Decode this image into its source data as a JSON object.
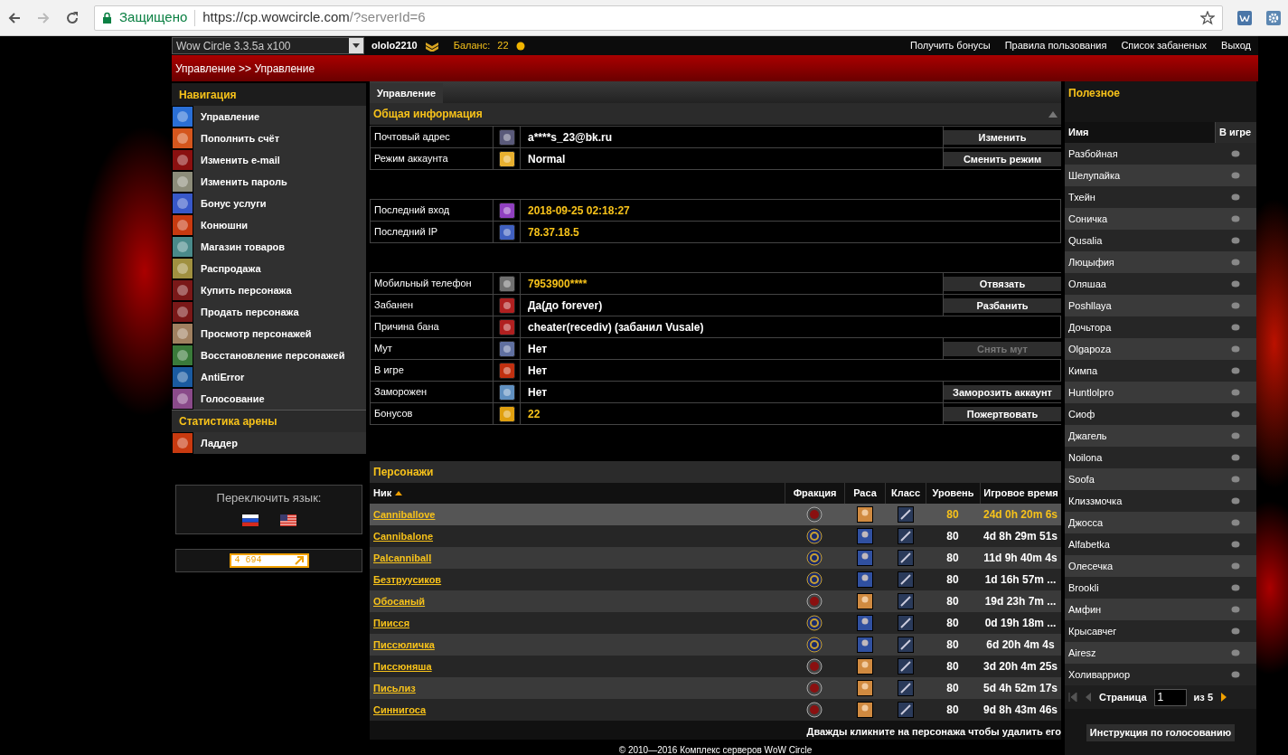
{
  "browser": {
    "security_label": "Защищено",
    "url_host": "https://cp.wowcircle.com",
    "url_path": "/?serverId=6"
  },
  "topbar": {
    "server_select": "Wow Circle 3.3.5a x100",
    "username": "ololo2210",
    "balance_label": "Баланс:",
    "balance": "22",
    "links": [
      "Получить бонусы",
      "Правила пользования",
      "Список забаненых",
      "Выход"
    ]
  },
  "breadcrumb": "Управление >> Управление",
  "sidebar": {
    "title": "Навигация",
    "items": [
      {
        "label": "Управление"
      },
      {
        "label": "Пополнить счёт"
      },
      {
        "label": "Изменить e-mail"
      },
      {
        "label": "Изменить пароль"
      },
      {
        "label": "Бонус услуги"
      },
      {
        "label": "Конюшни"
      },
      {
        "label": "Магазин товаров"
      },
      {
        "label": "Распродажа"
      },
      {
        "label": "Купить персонажа"
      },
      {
        "label": "Продать персонажа"
      },
      {
        "label": "Просмотр персонажей"
      },
      {
        "label": "Восстановление персонажей"
      },
      {
        "label": "AntiError"
      },
      {
        "label": "Голосование"
      }
    ],
    "arena_title": "Статистика арены",
    "arena_items": [
      {
        "label": "Ладдер"
      }
    ],
    "language_title": "Переключить язык:",
    "counter": "4 694"
  },
  "main": {
    "tab": "Управление",
    "section_title": "Общая информация",
    "groups": [
      [
        {
          "label": "Почтовый адрес",
          "value": "a****s_23@bk.ru",
          "accent": false,
          "button": {
            "label": "Изменить",
            "disabled": false
          }
        },
        {
          "label": "Режим аккаунта",
          "value": "Normal",
          "accent": false,
          "button": {
            "label": "Сменить режим",
            "disabled": false
          }
        }
      ],
      [
        {
          "label": "Последний вход",
          "value": "2018-09-25 02:18:27",
          "accent": true
        },
        {
          "label": "Последний IP",
          "value": "78.37.18.5",
          "accent": true
        }
      ],
      [
        {
          "label": "Мобильный телефон",
          "value": "7953900****",
          "accent": true,
          "button": {
            "label": "Отвязать",
            "disabled": false
          }
        },
        {
          "label": "Забанен",
          "value": "Да(до forever)",
          "accent": false,
          "button": {
            "label": "Разбанить",
            "disabled": false
          }
        },
        {
          "label": "Причина бана",
          "value": "cheater(recediv) (забанил Vusale)",
          "accent": false
        },
        {
          "label": "Мут",
          "value": "Нет",
          "accent": false,
          "button": {
            "label": "Снять мут",
            "disabled": true
          }
        },
        {
          "label": "В игре",
          "value": "Нет",
          "accent": false
        },
        {
          "label": "Заморожен",
          "value": "Нет",
          "accent": false,
          "button": {
            "label": "Заморозить аккаунт",
            "disabled": false
          }
        },
        {
          "label": "Бонусов",
          "value": "22",
          "accent": true,
          "button": {
            "label": "Пожертвовать",
            "disabled": false
          }
        }
      ]
    ]
  },
  "characters": {
    "title": "Персонажи",
    "columns": [
      {
        "label": "Ник",
        "sorted_ascending": true
      },
      {
        "label": "Фракция"
      },
      {
        "label": "Раса"
      },
      {
        "label": "Класс"
      },
      {
        "label": "Уровень"
      },
      {
        "label": "Игровое время"
      }
    ],
    "rows": [
      {
        "name": "Canniballove",
        "horde": true,
        "level": "80",
        "time": "24d 0h 20m 6s",
        "selected": true
      },
      {
        "name": "Cannibalone",
        "horde": false,
        "level": "80",
        "time": "4d 8h 29m 51s",
        "selected": false
      },
      {
        "name": "Palcanniball",
        "horde": false,
        "level": "80",
        "time": "11d 9h 40m 4s",
        "selected": false
      },
      {
        "name": "Безтруусиков",
        "horde": false,
        "level": "80",
        "time": "1d 16h 57m ...",
        "selected": false
      },
      {
        "name": "Обосаный",
        "horde": true,
        "level": "80",
        "time": "19d 23h 7m ...",
        "selected": false
      },
      {
        "name": "Пиисся",
        "horde": false,
        "level": "80",
        "time": "0d 19h 18m ...",
        "selected": false
      },
      {
        "name": "Писсюличка",
        "horde": false,
        "level": "80",
        "time": "6d 20h 4m 4s",
        "selected": false
      },
      {
        "name": "Писсюняша",
        "horde": true,
        "level": "80",
        "time": "3d 20h 4m 25s",
        "selected": false
      },
      {
        "name": "Письлиз",
        "horde": true,
        "level": "80",
        "time": "5d 4h 52m 17s",
        "selected": false
      },
      {
        "name": "Синнигоса",
        "horde": true,
        "level": "80",
        "time": "9d 8h 43m 46s",
        "selected": false
      }
    ],
    "hint": "Дважды кликните на персонажа чтобы удалить его"
  },
  "footer": "© 2010—2016 Комплекс серверов WoW Circle",
  "useful": {
    "title": "Полезное",
    "columns": [
      "Имя",
      "В игре"
    ],
    "rows": [
      {
        "name": "Разбойная",
        "online": false
      },
      {
        "name": "Шелупайка",
        "online": false
      },
      {
        "name": "Тхейн",
        "online": false
      },
      {
        "name": "Соничка",
        "online": false
      },
      {
        "name": "Qusalia",
        "online": false
      },
      {
        "name": "Люцыфия",
        "online": false
      },
      {
        "name": "Оляшаа",
        "online": false
      },
      {
        "name": "Poshllaya",
        "online": false
      },
      {
        "name": "Дочьтора",
        "online": false
      },
      {
        "name": "Olgapoza",
        "online": false
      },
      {
        "name": "Кимпа",
        "online": false
      },
      {
        "name": "Huntlolpro",
        "online": false
      },
      {
        "name": "Сиоф",
        "online": false
      },
      {
        "name": "Джагель",
        "online": false
      },
      {
        "name": "Noilona",
        "online": false
      },
      {
        "name": "Soofa",
        "online": false
      },
      {
        "name": "Клиззмочка",
        "online": false
      },
      {
        "name": "Джосса",
        "online": false
      },
      {
        "name": "Alfabetka",
        "online": false
      },
      {
        "name": "Олесечка",
        "online": false
      },
      {
        "name": "Brookli",
        "online": false
      },
      {
        "name": "Амфин",
        "online": false
      },
      {
        "name": "Крысавчег",
        "online": false
      },
      {
        "name": "Airesz",
        "online": false
      },
      {
        "name": "Холиварриор",
        "online": false
      }
    ],
    "pager": {
      "label": "Страница",
      "page": "1",
      "total": "из 5",
      "prev_disabled": true,
      "next_disabled": false
    },
    "vote_help": "Инструкция по голосованию"
  }
}
